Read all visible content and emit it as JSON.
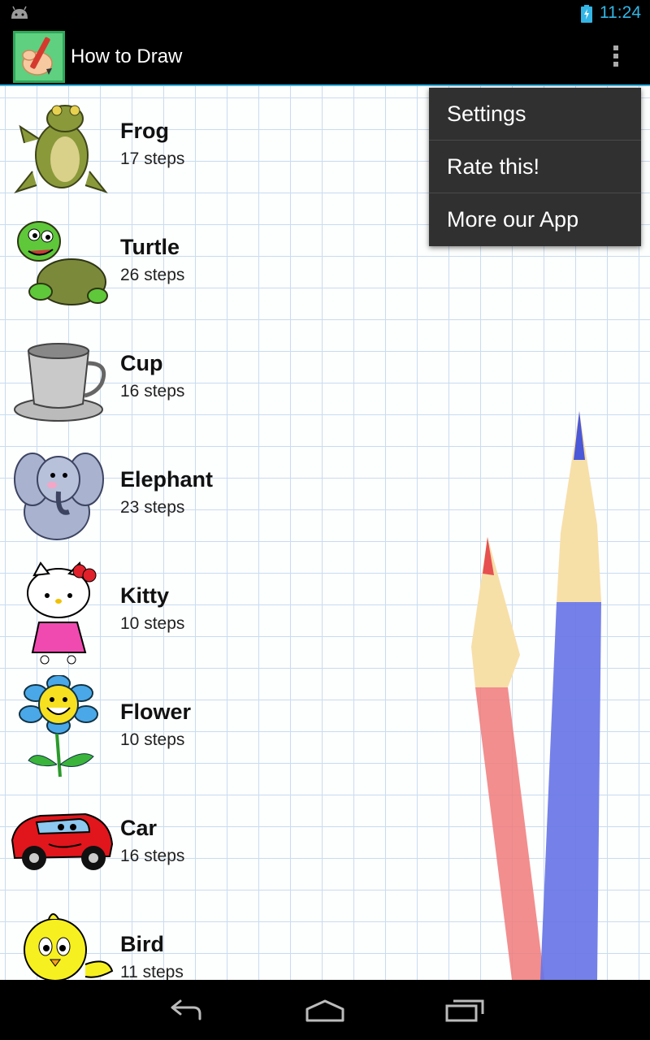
{
  "status_bar": {
    "time": "11:24",
    "icons": [
      "android-debug-icon",
      "battery-charging-icon"
    ]
  },
  "action_bar": {
    "title": "How to Draw",
    "app_icon": "pencil-hand-icon",
    "overflow_icon": "overflow-menu-icon"
  },
  "list": {
    "items": [
      {
        "name": "Frog",
        "steps": "17 steps",
        "icon": "frog-icon"
      },
      {
        "name": "Turtle",
        "steps": "26 steps",
        "icon": "turtle-icon"
      },
      {
        "name": "Cup",
        "steps": "16 steps",
        "icon": "cup-icon"
      },
      {
        "name": "Elephant",
        "steps": "23 steps",
        "icon": "elephant-icon"
      },
      {
        "name": "Kitty",
        "steps": "10 steps",
        "icon": "kitty-icon"
      },
      {
        "name": "Flower",
        "steps": "10 steps",
        "icon": "flower-icon"
      },
      {
        "name": "Car",
        "steps": "16 steps",
        "icon": "car-icon"
      },
      {
        "name": "Bird",
        "steps": "11 steps",
        "icon": "bird-icon"
      }
    ]
  },
  "menu": {
    "items": [
      "Settings",
      "Rate this!",
      "More our App"
    ]
  },
  "nav_bar": {
    "icons": [
      "back-icon",
      "home-icon",
      "recents-icon"
    ]
  },
  "colors": {
    "accent": "#33b5e5",
    "menu_bg": "#303030",
    "grid": "#c9dcef"
  }
}
